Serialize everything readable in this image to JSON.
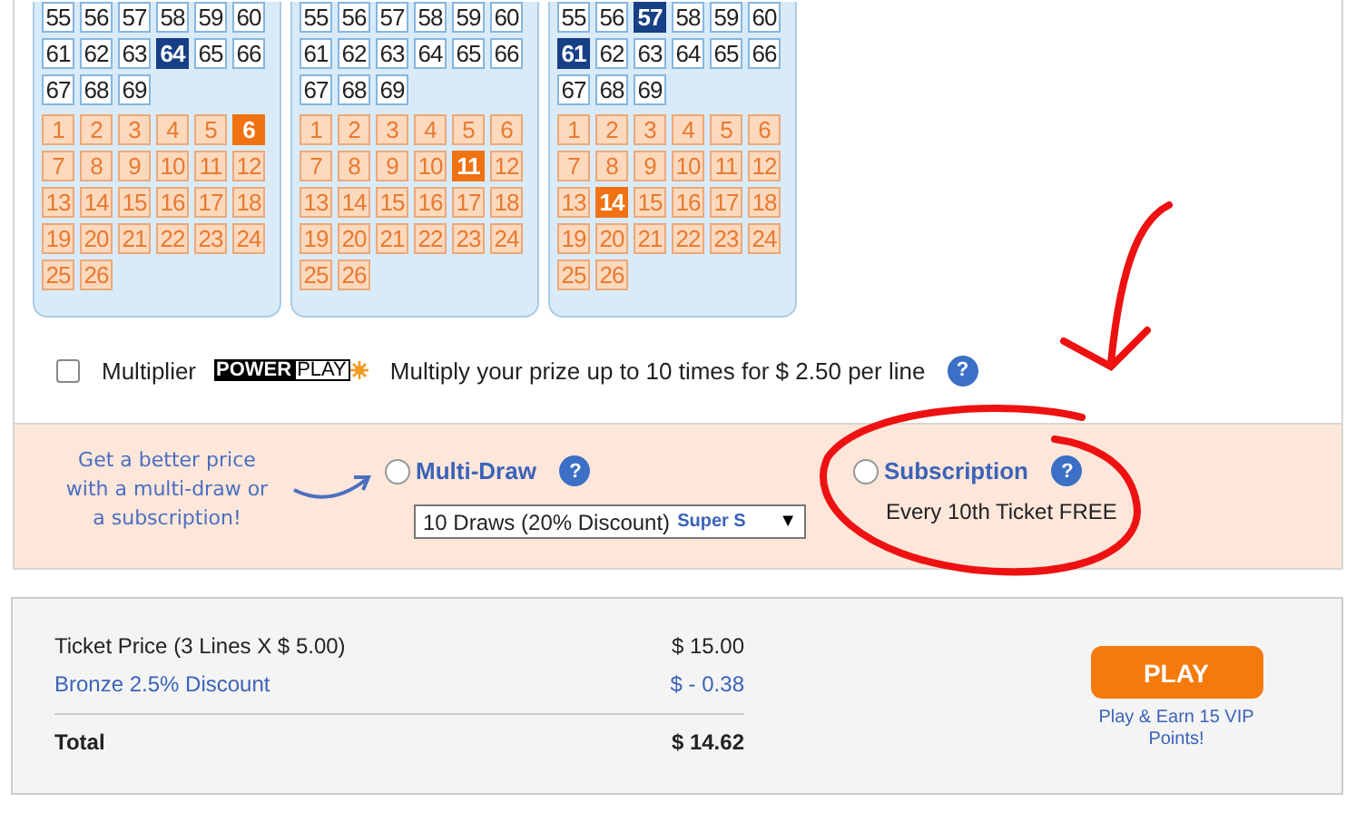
{
  "panels": [
    {
      "main": [
        {
          "n": "55",
          "selected": false
        },
        {
          "n": "56",
          "selected": false
        },
        {
          "n": "57",
          "selected": false
        },
        {
          "n": "58",
          "selected": false
        },
        {
          "n": "59",
          "selected": false
        },
        {
          "n": "60",
          "selected": false
        },
        {
          "n": "61",
          "selected": false
        },
        {
          "n": "62",
          "selected": false
        },
        {
          "n": "63",
          "selected": false
        },
        {
          "n": "64",
          "selected": true
        },
        {
          "n": "65",
          "selected": false
        },
        {
          "n": "66",
          "selected": false
        },
        {
          "n": "67",
          "selected": false
        },
        {
          "n": "68",
          "selected": false
        },
        {
          "n": "69",
          "selected": false
        }
      ],
      "bonus": [
        {
          "n": "1",
          "selected": false
        },
        {
          "n": "2",
          "selected": false
        },
        {
          "n": "3",
          "selected": false
        },
        {
          "n": "4",
          "selected": false
        },
        {
          "n": "5",
          "selected": false
        },
        {
          "n": "6",
          "selected": true
        },
        {
          "n": "7",
          "selected": false
        },
        {
          "n": "8",
          "selected": false
        },
        {
          "n": "9",
          "selected": false
        },
        {
          "n": "10",
          "selected": false
        },
        {
          "n": "11",
          "selected": false
        },
        {
          "n": "12",
          "selected": false
        },
        {
          "n": "13",
          "selected": false
        },
        {
          "n": "14",
          "selected": false
        },
        {
          "n": "15",
          "selected": false
        },
        {
          "n": "16",
          "selected": false
        },
        {
          "n": "17",
          "selected": false
        },
        {
          "n": "18",
          "selected": false
        },
        {
          "n": "19",
          "selected": false
        },
        {
          "n": "20",
          "selected": false
        },
        {
          "n": "21",
          "selected": false
        },
        {
          "n": "22",
          "selected": false
        },
        {
          "n": "23",
          "selected": false
        },
        {
          "n": "24",
          "selected": false
        },
        {
          "n": "25",
          "selected": false
        },
        {
          "n": "26",
          "selected": false
        }
      ]
    },
    {
      "main": [
        {
          "n": "55",
          "selected": false
        },
        {
          "n": "56",
          "selected": false
        },
        {
          "n": "57",
          "selected": false
        },
        {
          "n": "58",
          "selected": false
        },
        {
          "n": "59",
          "selected": false
        },
        {
          "n": "60",
          "selected": false
        },
        {
          "n": "61",
          "selected": false
        },
        {
          "n": "62",
          "selected": false
        },
        {
          "n": "63",
          "selected": false
        },
        {
          "n": "64",
          "selected": false
        },
        {
          "n": "65",
          "selected": false
        },
        {
          "n": "66",
          "selected": false
        },
        {
          "n": "67",
          "selected": false
        },
        {
          "n": "68",
          "selected": false
        },
        {
          "n": "69",
          "selected": false
        }
      ],
      "bonus": [
        {
          "n": "1",
          "selected": false
        },
        {
          "n": "2",
          "selected": false
        },
        {
          "n": "3",
          "selected": false
        },
        {
          "n": "4",
          "selected": false
        },
        {
          "n": "5",
          "selected": false
        },
        {
          "n": "6",
          "selected": false
        },
        {
          "n": "7",
          "selected": false
        },
        {
          "n": "8",
          "selected": false
        },
        {
          "n": "9",
          "selected": false
        },
        {
          "n": "10",
          "selected": false
        },
        {
          "n": "11",
          "selected": true
        },
        {
          "n": "12",
          "selected": false
        },
        {
          "n": "13",
          "selected": false
        },
        {
          "n": "14",
          "selected": false
        },
        {
          "n": "15",
          "selected": false
        },
        {
          "n": "16",
          "selected": false
        },
        {
          "n": "17",
          "selected": false
        },
        {
          "n": "18",
          "selected": false
        },
        {
          "n": "19",
          "selected": false
        },
        {
          "n": "20",
          "selected": false
        },
        {
          "n": "21",
          "selected": false
        },
        {
          "n": "22",
          "selected": false
        },
        {
          "n": "23",
          "selected": false
        },
        {
          "n": "24",
          "selected": false
        },
        {
          "n": "25",
          "selected": false
        },
        {
          "n": "26",
          "selected": false
        }
      ]
    },
    {
      "main": [
        {
          "n": "55",
          "selected": false
        },
        {
          "n": "56",
          "selected": false
        },
        {
          "n": "57",
          "selected": true
        },
        {
          "n": "58",
          "selected": false
        },
        {
          "n": "59",
          "selected": false
        },
        {
          "n": "60",
          "selected": false
        },
        {
          "n": "61",
          "selected": true
        },
        {
          "n": "62",
          "selected": false
        },
        {
          "n": "63",
          "selected": false
        },
        {
          "n": "64",
          "selected": false
        },
        {
          "n": "65",
          "selected": false
        },
        {
          "n": "66",
          "selected": false
        },
        {
          "n": "67",
          "selected": false
        },
        {
          "n": "68",
          "selected": false
        },
        {
          "n": "69",
          "selected": false
        }
      ],
      "bonus": [
        {
          "n": "1",
          "selected": false
        },
        {
          "n": "2",
          "selected": false
        },
        {
          "n": "3",
          "selected": false
        },
        {
          "n": "4",
          "selected": false
        },
        {
          "n": "5",
          "selected": false
        },
        {
          "n": "6",
          "selected": false
        },
        {
          "n": "7",
          "selected": false
        },
        {
          "n": "8",
          "selected": false
        },
        {
          "n": "9",
          "selected": false
        },
        {
          "n": "10",
          "selected": false
        },
        {
          "n": "11",
          "selected": false
        },
        {
          "n": "12",
          "selected": false
        },
        {
          "n": "13",
          "selected": false
        },
        {
          "n": "14",
          "selected": true
        },
        {
          "n": "15",
          "selected": false
        },
        {
          "n": "16",
          "selected": false
        },
        {
          "n": "17",
          "selected": false
        },
        {
          "n": "18",
          "selected": false
        },
        {
          "n": "19",
          "selected": false
        },
        {
          "n": "20",
          "selected": false
        },
        {
          "n": "21",
          "selected": false
        },
        {
          "n": "22",
          "selected": false
        },
        {
          "n": "23",
          "selected": false
        },
        {
          "n": "24",
          "selected": false
        },
        {
          "n": "25",
          "selected": false
        },
        {
          "n": "26",
          "selected": false
        }
      ]
    }
  ],
  "multiplier": {
    "label": "Multiplier",
    "checked": false,
    "logo_left": "POWER",
    "logo_right": "PLAY",
    "description": "Multiply your prize up to 10 times for $ 2.50 per line",
    "help": "?"
  },
  "promo": {
    "tagline": "Get a better price with a multi-draw or a subscription!",
    "multi_draw": {
      "label": "Multi-Draw",
      "selected": false,
      "help": "?",
      "select_value": "10 Draws (20% Discount)",
      "select_extra": "Super S",
      "select_caret": "▼"
    },
    "subscription": {
      "label": "Subscription",
      "selected": false,
      "help": "?",
      "note": "Every 10th Ticket FREE"
    }
  },
  "summary": {
    "rows": [
      {
        "kind": "plain",
        "label": "Ticket Price (3 Lines X $ 5.00)",
        "amount": "$ 15.00"
      },
      {
        "kind": "discount",
        "label": "Bronze 2.5% Discount",
        "amount": "$ - 0.38"
      },
      {
        "kind": "total",
        "label": "Total",
        "amount": "$ 14.62"
      }
    ],
    "play_button": "PLAY",
    "play_note": "Play & Earn 15 VIP Points!"
  },
  "annotations": [
    {
      "kind": "arrow"
    },
    {
      "kind": "circle"
    }
  ]
}
